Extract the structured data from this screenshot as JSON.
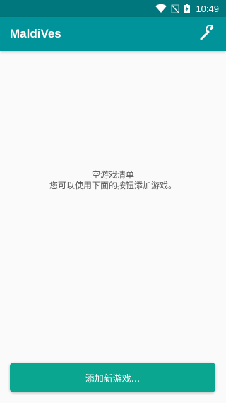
{
  "status_bar": {
    "time": "10:49",
    "icons": [
      "wifi-icon",
      "no-signal-icon",
      "battery-charging-icon"
    ]
  },
  "app_bar": {
    "title": "MaldiVes",
    "settings_icon": "wrench-icon",
    "background": "#00939a"
  },
  "empty_state": {
    "title": "空游戏清单",
    "message": "您可以使用下面的按钮添加游戏。"
  },
  "add_button": {
    "label": "添加新游戏...",
    "background": "#0aa68f"
  },
  "colors": {
    "status_bar": "#00777c",
    "background": "#fafafa"
  }
}
